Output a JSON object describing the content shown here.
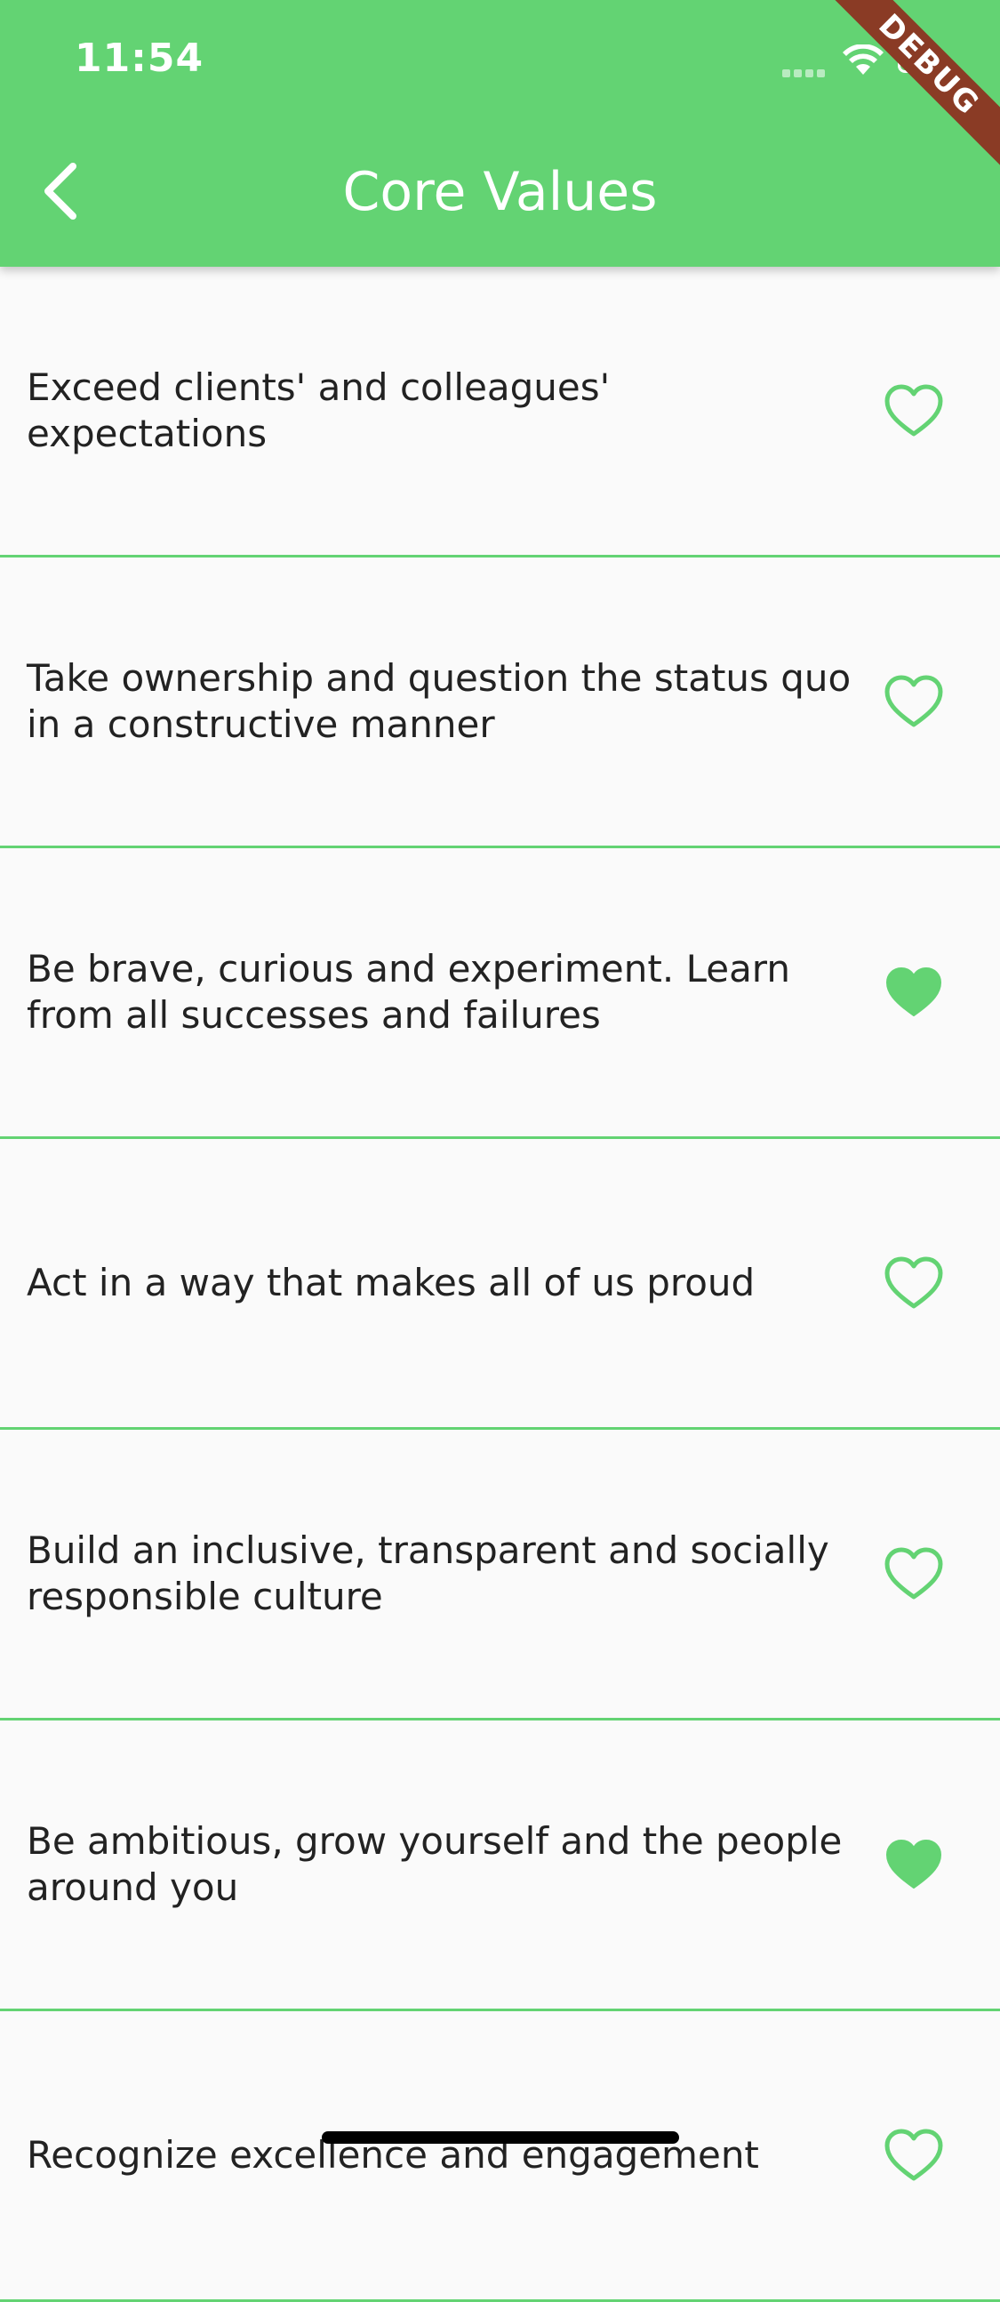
{
  "status_bar": {
    "time": "11:54"
  },
  "app_bar": {
    "title": "Core Values",
    "back_icon": "chevron-left-icon"
  },
  "debug_banner": "DEBUG",
  "colors": {
    "accent": "#63d373",
    "text": "#222222",
    "background": "#fafafa",
    "ribbon": "#8a3b25"
  },
  "values": [
    {
      "text": "Exceed clients' and colleagues' expectations",
      "favorite": false,
      "icon": "heart-outline-icon"
    },
    {
      "text": "Take ownership and question the status quo in a constructive manner",
      "favorite": false,
      "icon": "heart-outline-icon"
    },
    {
      "text": "Be brave, curious and experiment. Learn from all successes and failures",
      "favorite": true,
      "icon": "heart-filled-icon"
    },
    {
      "text": "Act in a way that makes all of us proud",
      "favorite": false,
      "icon": "heart-outline-icon"
    },
    {
      "text": "Build an inclusive, transparent and socially responsible culture",
      "favorite": false,
      "icon": "heart-outline-icon"
    },
    {
      "text": "Be ambitious, grow yourself and the people around you",
      "favorite": true,
      "icon": "heart-filled-icon"
    },
    {
      "text": "Recognize excellence and engagement",
      "favorite": false,
      "icon": "heart-outline-icon"
    }
  ]
}
